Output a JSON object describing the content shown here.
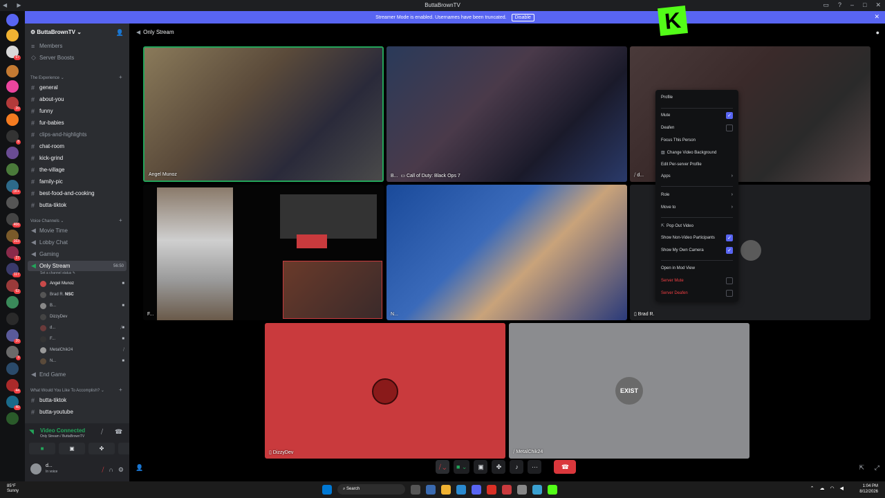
{
  "window": {
    "title": "ButtaBrownTV"
  },
  "banner": {
    "text": "Streamer Mode is enabled. Usernames have been truncated.",
    "button": "Disable"
  },
  "kick_logo": "K",
  "server": {
    "name": "ButtaBrownTV"
  },
  "sidebar": {
    "top_items": [
      "Members",
      "Server Boosts"
    ],
    "categories": [
      "The Experience",
      "Voice Channels",
      "What Would You Like To Accomplish?"
    ],
    "text_channels": [
      "general",
      "about-you",
      "funny",
      "fur-babies",
      "clips-and-highlights",
      "chat-room",
      "kick-grind",
      "the-village",
      "family-pic",
      "best-food-and-cooking",
      "butta-tiktok"
    ],
    "voice_channels": [
      "Movie Time",
      "Lobby Chat",
      "Gaming",
      "Only Stream"
    ],
    "only_stream_timer": "56:50",
    "channel_status": "Set a channel status",
    "voice_users": [
      "Angel Munoz",
      "Brad R.",
      "B...",
      "DizzyDev",
      "d...",
      "F...",
      "MetalChik24",
      "N..."
    ],
    "nsc_tag": "NSC",
    "end_channel": "End Game",
    "bottom_channels": [
      "butta-tiktok",
      "butta-youtube"
    ]
  },
  "voice_panel": {
    "status": "Video Connected",
    "location": "Only Stream / ButtaBrownTV"
  },
  "user_panel": {
    "name": "d...",
    "status": "In voice"
  },
  "stage": {
    "title": "Only Stream"
  },
  "tiles": {
    "angel": "Angel Munoz",
    "b": "B...",
    "game": "Call of Duty: Black Ops 7",
    "d": "d...",
    "f": "F...",
    "n": "N...",
    "brad": "Brad R.",
    "dizzy": "DizzyDev",
    "metal": "MetalChik24",
    "exist_logo": "EXIST"
  },
  "menu": {
    "profile": "Profile",
    "mute": "Mute",
    "deafen": "Deafen",
    "focus": "Focus This Person",
    "change_bg": "Change Video Background",
    "edit_profile": "Edit Per-server Profile",
    "apps": "Apps",
    "role": "Role",
    "move_to": "Move to",
    "pop_out": "Pop Out Video",
    "show_non_video": "Show Non-Video Participants",
    "show_camera": "Show My Own Camera",
    "mod_view": "Open in Mod View",
    "server_mute": "Server Mute",
    "server_deafen": "Server Deafen"
  },
  "taskbar": {
    "temp": "85°F",
    "weather": "Sunny",
    "search": "Search",
    "time": "1:04 PM",
    "date": "8/12/2026"
  },
  "colors": {
    "blurple": "#5865f2",
    "kick_green": "#53fc18",
    "danger": "#f23f43",
    "dizzy_tile": "#c93a3d",
    "metal_tile": "#8b8c8f"
  }
}
